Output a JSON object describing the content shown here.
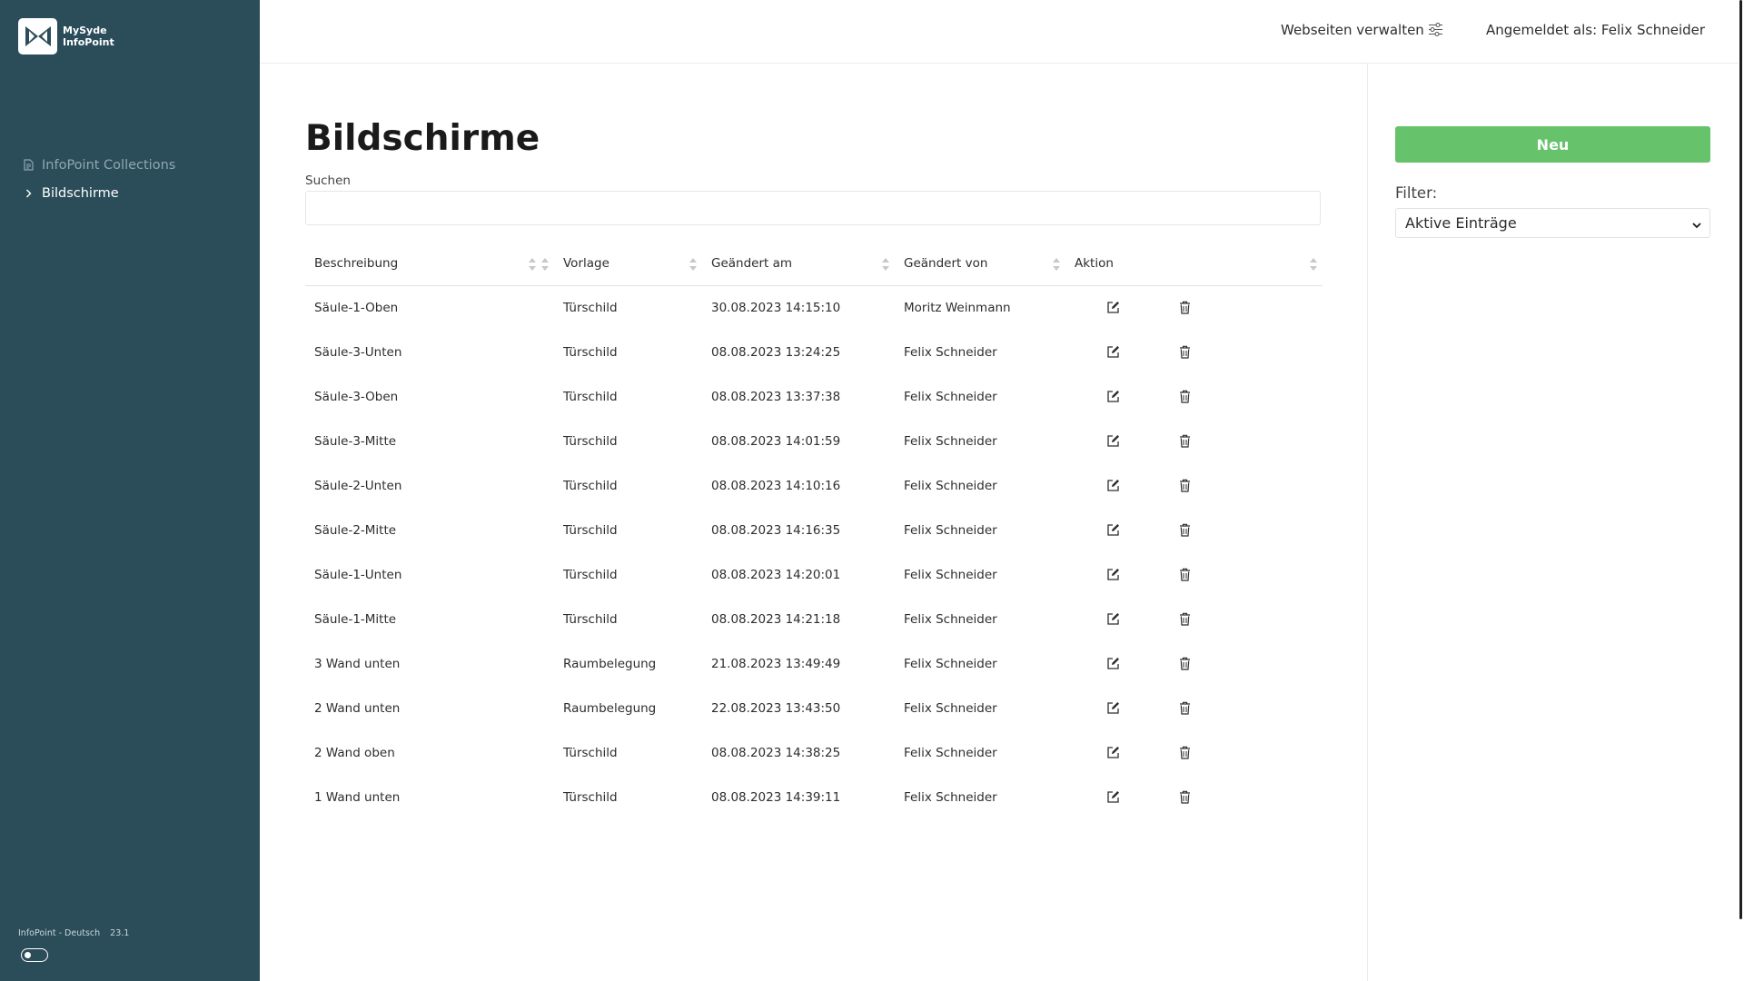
{
  "app": {
    "name_line1": "MySyde",
    "name_line2": "InfoPoint"
  },
  "sidebar": {
    "items": [
      {
        "label": "InfoPoint Collections",
        "icon": "document-icon"
      },
      {
        "label": "Bildschirme",
        "icon": "chevron-right-icon"
      }
    ],
    "footer": {
      "language": "InfoPoint - Deutsch",
      "version": "23.1"
    }
  },
  "header": {
    "manage_label": "Webseiten verwalten",
    "user_label": "Angemeldet als: Felix Schneider"
  },
  "main": {
    "title": "Bildschirme",
    "search": {
      "label": "Suchen",
      "value": "",
      "placeholder": ""
    },
    "columns": [
      "Beschreibung",
      "",
      "Vorlage",
      "Geändert am",
      "Geändert von",
      "Aktion"
    ],
    "rows": [
      {
        "beschreibung": "Säule-1-Oben",
        "vorlage": "Türschild",
        "geaendert_am": "30.08.2023 14:15:10",
        "geaendert_von": "Moritz Weinmann"
      },
      {
        "beschreibung": "Säule-3-Unten",
        "vorlage": "Türschild",
        "geaendert_am": "08.08.2023 13:24:25",
        "geaendert_von": "Felix Schneider"
      },
      {
        "beschreibung": "Säule-3-Oben",
        "vorlage": "Türschild",
        "geaendert_am": "08.08.2023 13:37:38",
        "geaendert_von": "Felix Schneider"
      },
      {
        "beschreibung": "Säule-3-Mitte",
        "vorlage": "Türschild",
        "geaendert_am": "08.08.2023 14:01:59",
        "geaendert_von": "Felix Schneider"
      },
      {
        "beschreibung": "Säule-2-Unten",
        "vorlage": "Türschild",
        "geaendert_am": "08.08.2023 14:10:16",
        "geaendert_von": "Felix Schneider"
      },
      {
        "beschreibung": "Säule-2-Mitte",
        "vorlage": "Türschild",
        "geaendert_am": "08.08.2023 14:16:35",
        "geaendert_von": "Felix Schneider"
      },
      {
        "beschreibung": "Säule-1-Unten",
        "vorlage": "Türschild",
        "geaendert_am": "08.08.2023 14:20:01",
        "geaendert_von": "Felix Schneider"
      },
      {
        "beschreibung": "Säule-1-Mitte",
        "vorlage": "Türschild",
        "geaendert_am": "08.08.2023 14:21:18",
        "geaendert_von": "Felix Schneider"
      },
      {
        "beschreibung": "3 Wand unten",
        "vorlage": "Raumbelegung",
        "geaendert_am": "21.08.2023 13:49:49",
        "geaendert_von": "Felix Schneider"
      },
      {
        "beschreibung": "2 Wand unten",
        "vorlage": "Raumbelegung",
        "geaendert_am": "22.08.2023 13:43:50",
        "geaendert_von": "Felix Schneider"
      },
      {
        "beschreibung": "2 Wand oben",
        "vorlage": "Türschild",
        "geaendert_am": "08.08.2023 14:38:25",
        "geaendert_von": "Felix Schneider"
      },
      {
        "beschreibung": "1 Wand unten",
        "vorlage": "Türschild",
        "geaendert_am": "08.08.2023 14:39:11",
        "geaendert_von": "Felix Schneider"
      }
    ]
  },
  "aside": {
    "new_button": "Neu",
    "filter_label": "Filter:",
    "filter_value": "Aktive Einträge"
  },
  "colors": {
    "sidebar": "#2b4d5a",
    "accent_green": "#66c26b",
    "text": "#2d2d2d"
  }
}
